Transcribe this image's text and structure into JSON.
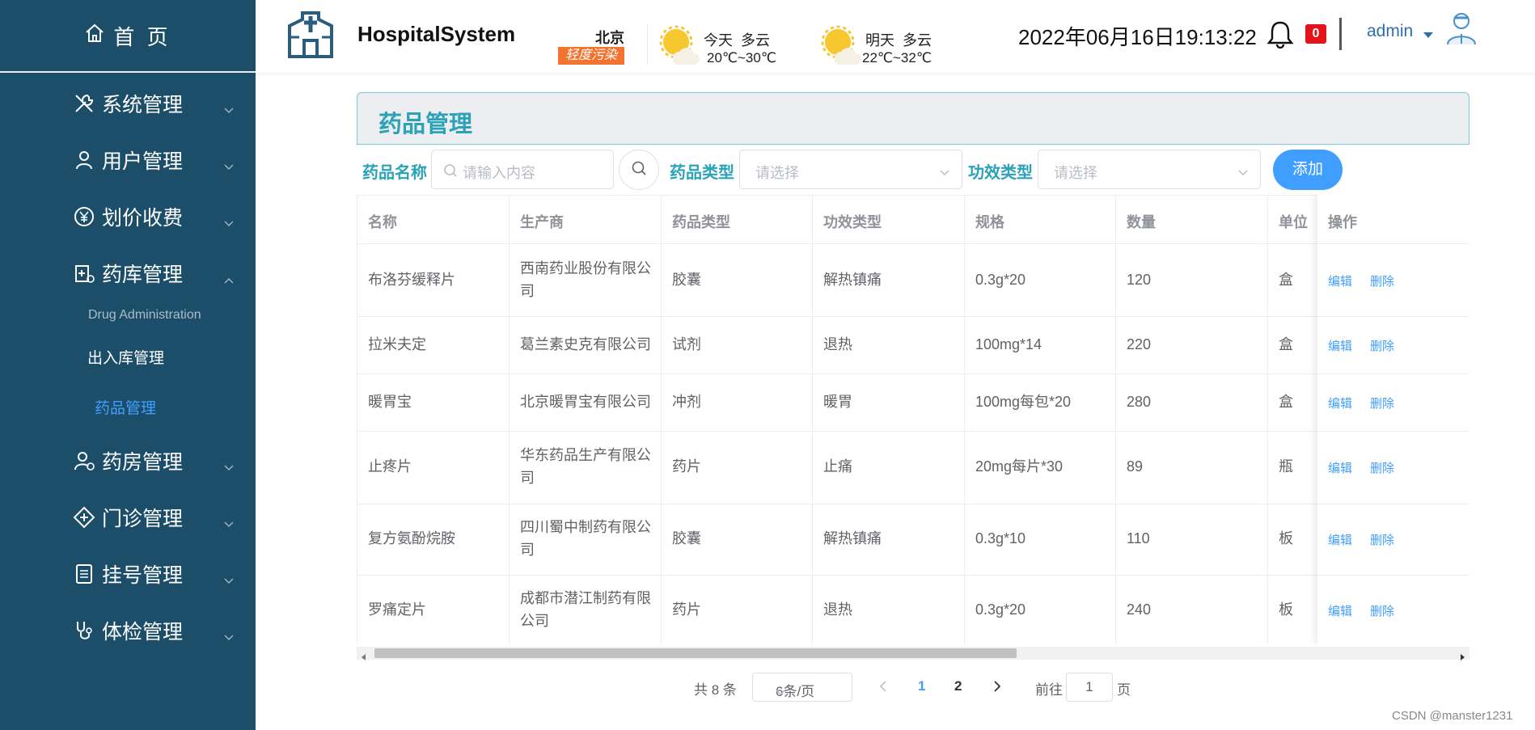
{
  "sidebar": {
    "home_label": "首 页",
    "menus": [
      {
        "label": "系统管理",
        "icon": "tools-icon"
      },
      {
        "label": "用户管理",
        "icon": "user-icon"
      },
      {
        "label": "划价收费",
        "icon": "yuan-icon"
      },
      {
        "label": "药库管理",
        "icon": "medicine-cabinet-icon"
      },
      {
        "label": "药房管理",
        "icon": "pharmacy-user-icon"
      },
      {
        "label": "门诊管理",
        "icon": "clinic-icon"
      },
      {
        "label": "挂号管理",
        "icon": "register-icon"
      },
      {
        "label": "体检管理",
        "icon": "stethoscope-icon"
      }
    ],
    "submenu_group_title": "Drug Administration",
    "submenu_items": [
      "出入库管理",
      "药品管理"
    ],
    "active_submenu": "药品管理"
  },
  "header": {
    "app_name": "HospitalSystem",
    "city": "北京",
    "pollution": "轻度污染",
    "weather_today": {
      "day": "今天",
      "condition": "多云",
      "temp": "20℃~30℃"
    },
    "weather_tomorrow": {
      "day": "明天",
      "condition": "多云",
      "temp": "22℃~32℃"
    },
    "datetime": "2022年06月16日19:13:22",
    "notification_count": "0",
    "username": "admin"
  },
  "page": {
    "title": "药品管理"
  },
  "filters": {
    "name_label": "药品名称",
    "name_placeholder": "请输入内容",
    "type_label": "药品类型",
    "type_placeholder": "请选择",
    "effect_label": "功效类型",
    "effect_placeholder": "请选择",
    "add_label": "添加"
  },
  "table": {
    "headers": [
      "名称",
      "生产商",
      "药品类型",
      "功效类型",
      "规格",
      "数量",
      "单位",
      "操作"
    ],
    "rows": [
      {
        "name": "布洛芬缓释片",
        "maker1": "西南药业股份有限公",
        "maker2": "司",
        "type": "胶囊",
        "effect": "解热镇痛",
        "spec": "0.3g*20",
        "qty": "120",
        "unit": "盒"
      },
      {
        "name": "拉米夫定",
        "maker1": "葛兰素史克有限公司",
        "maker2": "",
        "type": "试剂",
        "effect": "退热",
        "spec": "100mg*14",
        "qty": "220",
        "unit": "盒"
      },
      {
        "name": "暖胃宝",
        "maker1": "北京暖胃宝有限公司",
        "maker2": "",
        "type": "冲剂",
        "effect": "暖胃",
        "spec": "100mg每包*20",
        "qty": "280",
        "unit": "盒"
      },
      {
        "name": "止疼片",
        "maker1": "华东药品生产有限公",
        "maker2": "司",
        "type": "药片",
        "effect": "止痛",
        "spec": "20mg每片*30",
        "qty": "89",
        "unit": "瓶"
      },
      {
        "name": "复方氨酚烷胺",
        "maker1": "四川蜀中制药有限公",
        "maker2": "司",
        "type": "胶囊",
        "effect": "解热镇痛",
        "spec": "0.3g*10",
        "qty": "110",
        "unit": "板"
      },
      {
        "name": "罗痛定片",
        "maker1": "成都市潜江制药有限",
        "maker2": "公司",
        "type": "药片",
        "effect": "退热",
        "spec": "0.3g*20",
        "qty": "240",
        "unit": "板"
      }
    ],
    "edit_label": "编辑",
    "delete_label": "删除"
  },
  "pagination": {
    "total": "共 8 条",
    "page_size": "6条/页",
    "pages": [
      "1",
      "2"
    ],
    "current_page": "1",
    "goto_label": "前往",
    "goto_value": "1",
    "page_suffix": "页"
  },
  "watermark": "CSDN @manster1231"
}
